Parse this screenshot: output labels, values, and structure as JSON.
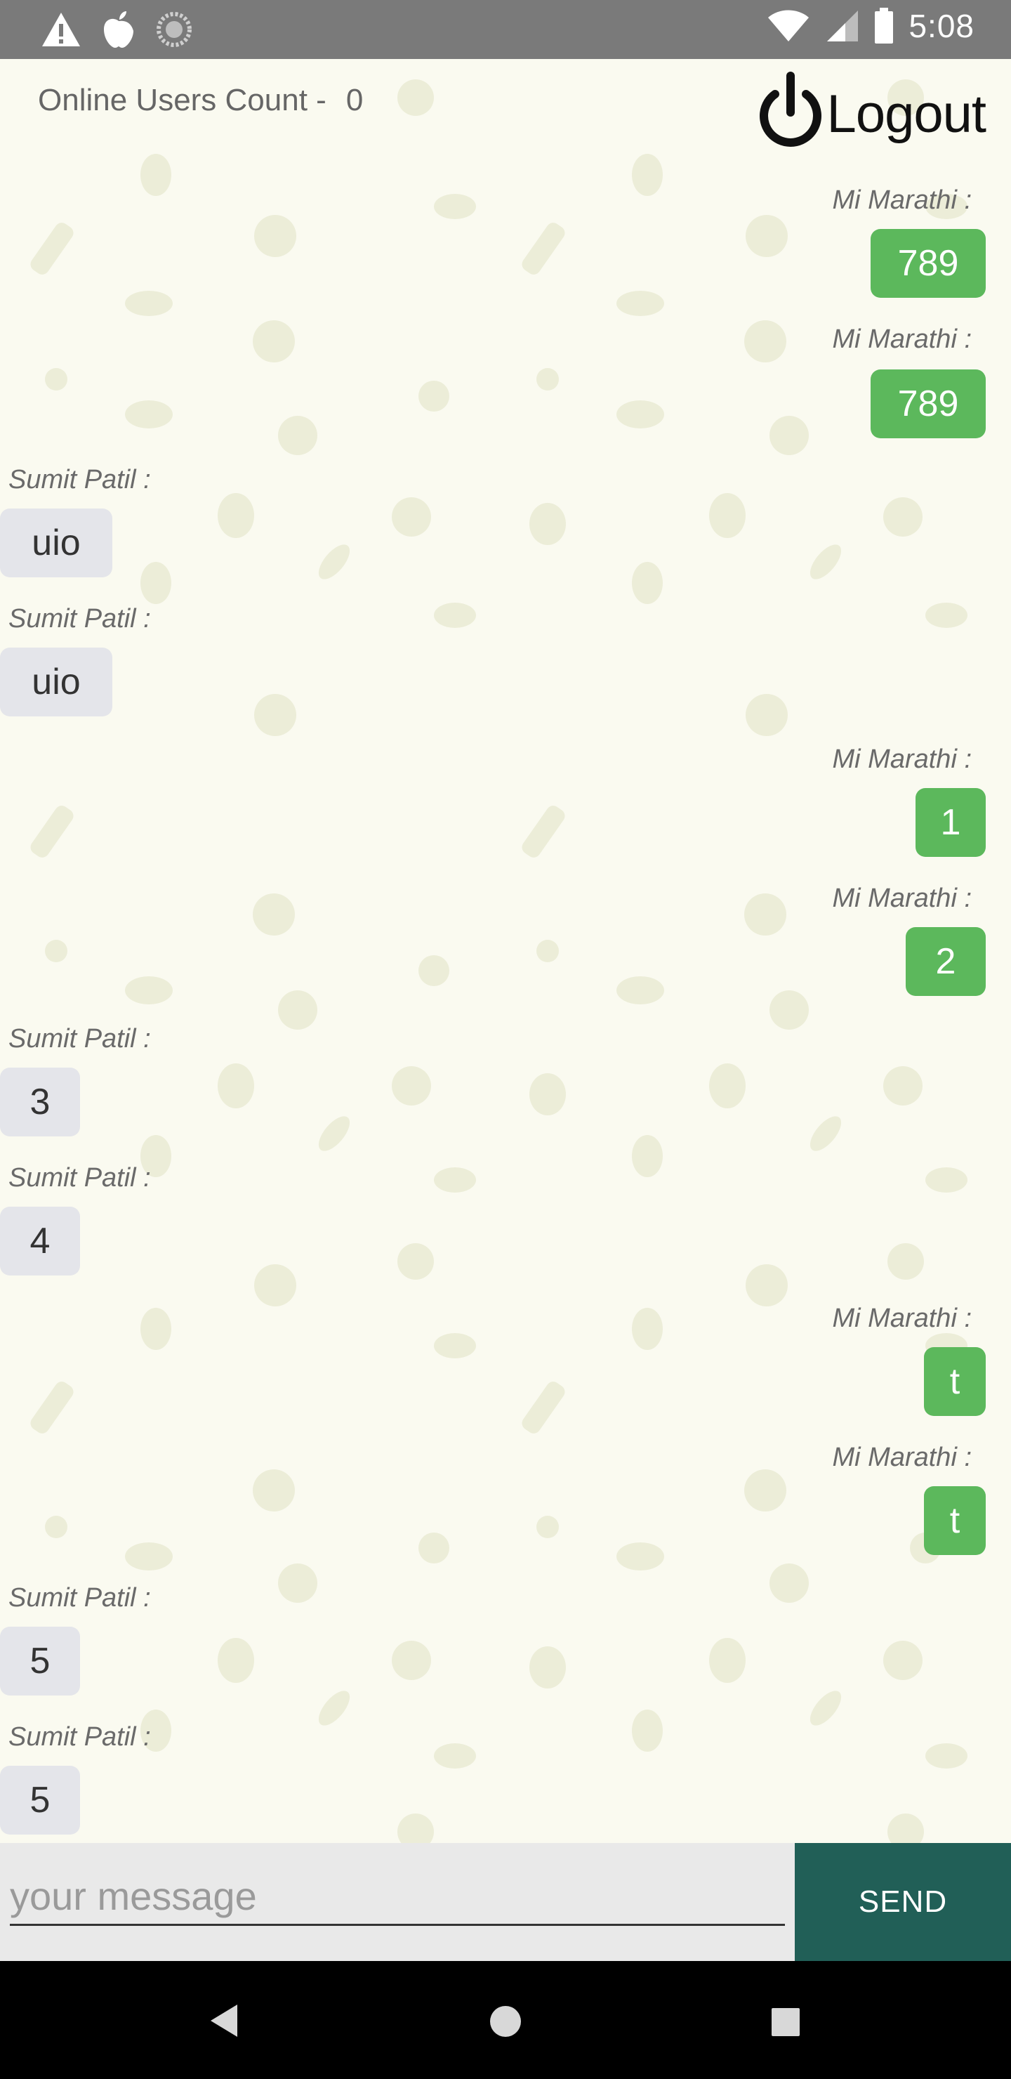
{
  "status_bar": {
    "time": "5:08",
    "left_icons": [
      "warning-icon",
      "apple-icon",
      "sync-icon"
    ],
    "right_icons": [
      "wifi-icon",
      "signal-icon",
      "battery-icon"
    ]
  },
  "header": {
    "online_label": "Online Users Count -",
    "online_count": "0",
    "logout_label": "Logout"
  },
  "messages": [
    {
      "sender": "Mi Marathi :",
      "text": "789",
      "mine": true
    },
    {
      "sender": "Mi Marathi :",
      "text": "789",
      "mine": true
    },
    {
      "sender": "Sumit Patil :",
      "text": "uio",
      "mine": false
    },
    {
      "sender": "Sumit Patil :",
      "text": "uio",
      "mine": false
    },
    {
      "sender": "Mi Marathi :",
      "text": "1",
      "mine": true
    },
    {
      "sender": "Mi Marathi :",
      "text": "2",
      "mine": true
    },
    {
      "sender": "Sumit Patil :",
      "text": "3",
      "mine": false
    },
    {
      "sender": "Sumit Patil :",
      "text": "4",
      "mine": false
    },
    {
      "sender": "Mi Marathi :",
      "text": "t",
      "mine": true
    },
    {
      "sender": "Mi Marathi :",
      "text": "t",
      "mine": true
    },
    {
      "sender": "Sumit Patil :",
      "text": "5",
      "mine": false
    },
    {
      "sender": "Sumit Patil :",
      "text": "5",
      "mine": false
    }
  ],
  "composer": {
    "placeholder": "your message",
    "send_label": "SEND"
  },
  "nav_bar": {
    "icons": [
      "back-icon",
      "home-icon",
      "recents-icon"
    ]
  },
  "colors": {
    "my_bubble": "#5cb85c",
    "their_bubble": "#e4e5ea",
    "send_button": "#215f57",
    "background": "#fafaf0"
  }
}
